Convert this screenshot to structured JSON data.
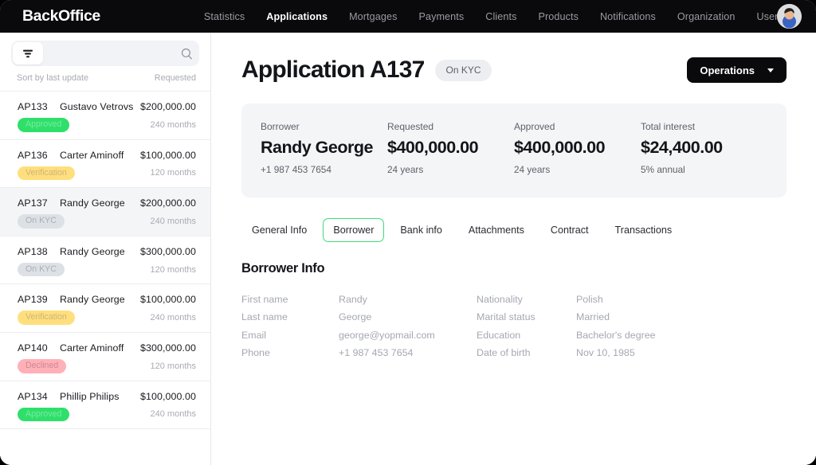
{
  "brand": "BackOffice",
  "nav": {
    "items": [
      {
        "label": "Statistics",
        "active": false
      },
      {
        "label": "Applications",
        "active": true
      },
      {
        "label": "Mortgages",
        "active": false
      },
      {
        "label": "Payments",
        "active": false
      },
      {
        "label": "Clients",
        "active": false
      },
      {
        "label": "Products",
        "active": false
      },
      {
        "label": "Notifications",
        "active": false
      },
      {
        "label": "Organization",
        "active": false
      },
      {
        "label": "Users",
        "active": false
      }
    ],
    "avatar_icon": "user-avatar"
  },
  "sidebar": {
    "search": {
      "value": "",
      "placeholder": "",
      "icon": "search-icon",
      "filter_icon": "filter-icon"
    },
    "sort_label": "Sort by last update",
    "column_label": "Requested",
    "applications": [
      {
        "id": "AP133",
        "name": "Gustavo Vetrovs",
        "amount": "$200,000.00",
        "status": "Approved",
        "status_key": "approved",
        "term": "240 months",
        "selected": false
      },
      {
        "id": "AP136",
        "name": "Carter Aminoff",
        "amount": "$100,000.00",
        "status": "Verification",
        "status_key": "verification",
        "term": "120 months",
        "selected": false
      },
      {
        "id": "AP137",
        "name": "Randy George",
        "amount": "$200,000.00",
        "status": "On KYC",
        "status_key": "onkyc",
        "term": "240 months",
        "selected": true
      },
      {
        "id": "AP138",
        "name": "Randy George",
        "amount": "$300,000.00",
        "status": "On KYC",
        "status_key": "onkyc",
        "term": "120 months",
        "selected": false
      },
      {
        "id": "AP139",
        "name": "Randy George",
        "amount": "$100,000.00",
        "status": "Verification",
        "status_key": "verification",
        "term": "240 months",
        "selected": false
      },
      {
        "id": "AP140",
        "name": "Carter Aminoff",
        "amount": "$300,000.00",
        "status": "Declined",
        "status_key": "declined",
        "term": "120 months",
        "selected": false
      },
      {
        "id": "AP134",
        "name": "Phillip Philips",
        "amount": "$100,000.00",
        "status": "Approved",
        "status_key": "approved",
        "term": "240 months",
        "selected": false
      }
    ]
  },
  "main": {
    "title": "Application A137",
    "status_badge": "On KYC",
    "operations_button": "Operations",
    "summary": [
      {
        "label": "Borrower",
        "value": "Randy George",
        "sub": "+1 987 453 7654"
      },
      {
        "label": "Requested",
        "value": "$400,000.00",
        "sub": "24 years"
      },
      {
        "label": "Approved",
        "value": "$400,000.00",
        "sub": "24 years"
      },
      {
        "label": "Total interest",
        "value": "$24,400.00",
        "sub": "5% annual"
      }
    ],
    "tabs": [
      {
        "label": "General Info",
        "active": false
      },
      {
        "label": "Borrower",
        "active": true
      },
      {
        "label": "Bank info",
        "active": false
      },
      {
        "label": "Attachments",
        "active": false
      },
      {
        "label": "Contract",
        "active": false
      },
      {
        "label": "Transactions",
        "active": false
      }
    ],
    "borrower_section_title": "Borrower Info",
    "borrower_left": [
      {
        "key": "First name",
        "value": "Randy"
      },
      {
        "key": "Last name",
        "value": "George"
      },
      {
        "key": "Email",
        "value": "george@yopmail.com"
      },
      {
        "key": "Phone",
        "value": "+1 987 453 7654"
      }
    ],
    "borrower_right": [
      {
        "key": "Nationality",
        "value": "Polish"
      },
      {
        "key": "Marital status",
        "value": "Married"
      },
      {
        "key": "Education",
        "value": "Bachelor's degree"
      },
      {
        "key": "Date of birth",
        "value": "Nov 10, 1985"
      }
    ]
  },
  "colors": {
    "accent_green": "#3ddc7a",
    "badge_approved": "#2ee06a",
    "badge_verification": "#ffdf7d",
    "badge_onkyc": "#dde1e6",
    "badge_declined": "#ffb0b8",
    "nav_bg": "#0a0a0c",
    "card_bg": "#f4f5f7"
  }
}
